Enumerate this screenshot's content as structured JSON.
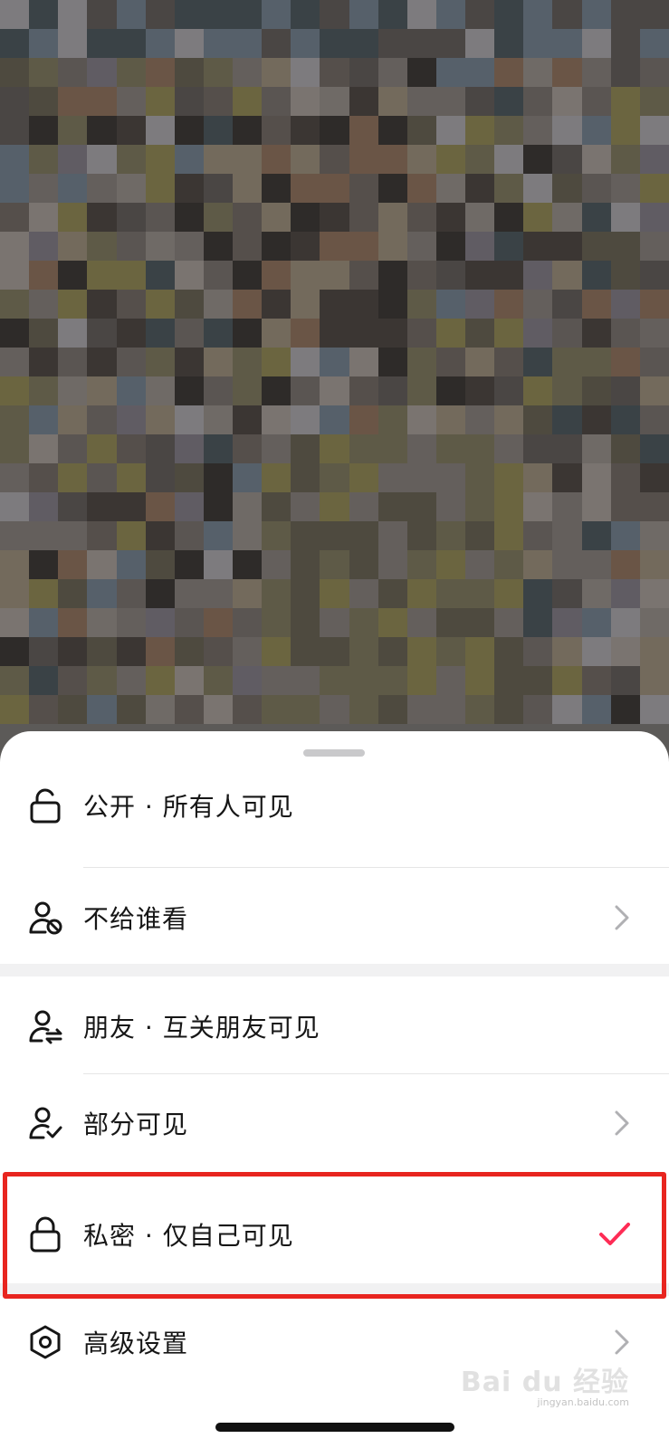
{
  "sheet": {
    "options": [
      {
        "label": "公开 · 所有人可见",
        "icon": "unlock-icon",
        "trailing": "none"
      },
      {
        "label": "不给谁看",
        "icon": "user-block-icon",
        "trailing": "chevron"
      },
      {
        "label": "朋友 · 互关朋友可见",
        "icon": "user-swap-icon",
        "trailing": "none"
      },
      {
        "label": "部分可见",
        "icon": "user-check-icon",
        "trailing": "chevron"
      },
      {
        "label": "私密 · 仅自己可见",
        "icon": "lock-icon",
        "trailing": "check",
        "selected": true
      },
      {
        "label": "高级设置",
        "icon": "settings-hex-icon",
        "trailing": "chevron"
      }
    ]
  },
  "watermark": {
    "text": "Bai du 经验",
    "sub": "jingyan.baidu.com"
  },
  "colors": {
    "accent_check": "#fe2c55",
    "highlight_border": "#e8251f"
  }
}
